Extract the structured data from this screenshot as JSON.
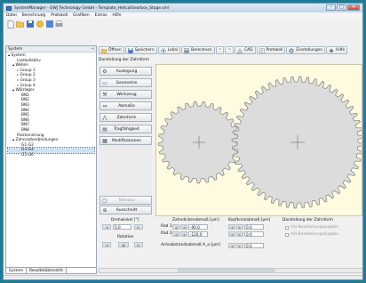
{
  "window": {
    "title": "SystemManager - GWJ Technology GmbH - Template_HelicalGearbox_Stage.sml",
    "buttons": {
      "minimize": "–",
      "maximize": "□",
      "close": "✕"
    }
  },
  "menu": [
    "Datei",
    "Berechnung",
    "Protokoll",
    "Grafiken",
    "Extras",
    "Hilfe"
  ],
  "toolbar": {
    "icons": [
      "new-file-icon",
      "open-folder-icon",
      "save-icon",
      "info-icon",
      "module-icon",
      "print-icon"
    ],
    "buttons": [
      {
        "label": "Öffnen",
        "icon": "open-icon"
      },
      {
        "label": "Speichern",
        "icon": "save-icon"
      },
      {
        "label": "Lokal",
        "icon": "radio-icon"
      },
      {
        "label": "Berechnen",
        "icon": "calculate-icon"
      },
      {
        "label": "",
        "icon": "undo-icon"
      },
      {
        "label": "",
        "icon": "redo-icon"
      },
      {
        "label": "CAD",
        "icon": "cad-icon"
      },
      {
        "label": "Protokoll",
        "icon": "report-icon"
      },
      {
        "label": "Einstellungen",
        "icon": "settings-icon"
      },
      {
        "label": "Hilfe",
        "icon": "help-icon"
      }
    ]
  },
  "left_panel": {
    "header": "System",
    "tree": [
      {
        "text": "▴ System",
        "level": 0
      },
      {
        "text": "Lastkollektiv",
        "level": 2
      },
      {
        "text": "▴ Wellen",
        "level": 1
      },
      {
        "text": "▹ Group 1",
        "level": 2
      },
      {
        "text": "▹ Group 2",
        "level": 2
      },
      {
        "text": "▹ Group 3",
        "level": 2
      },
      {
        "text": "▹ Group 4",
        "level": 2
      },
      {
        "text": "▴ Wälzlager",
        "level": 1
      },
      {
        "text": "BN1",
        "level": 3
      },
      {
        "text": "BN2",
        "level": 3
      },
      {
        "text": "BN3",
        "level": 3
      },
      {
        "text": "BN4",
        "level": 3
      },
      {
        "text": "BN5",
        "level": 3
      },
      {
        "text": "BN6",
        "level": 3
      },
      {
        "text": "BN7",
        "level": 3
      },
      {
        "text": "BN8",
        "level": 3
      },
      {
        "text": "Positionierung",
        "level": 2
      },
      {
        "text": "▴ Zahnradverbindungen",
        "level": 1
      },
      {
        "text": "G1-G2",
        "level": 3
      },
      {
        "text": "G3-G4",
        "level": 3,
        "selected": true
      },
      {
        "text": "G5-G6",
        "level": 3
      }
    ],
    "tabs": [
      "System",
      "Resultatübersicht"
    ]
  },
  "main": {
    "subtitle": "Darstellung der Zahnform",
    "side_buttons": [
      {
        "label": "Auslegung",
        "icon": "gear-icon"
      },
      {
        "label": "Geometrie",
        "icon": "geometry-icon"
      },
      {
        "label": "Werkzeug",
        "icon": "tool-icon"
      },
      {
        "label": "Abmaße",
        "icon": "tolerance-icon"
      },
      {
        "label": "Zahnform",
        "icon": "tooth-form-icon"
      },
      {
        "label": "Tragfähigkeit",
        "icon": "capacity-icon"
      },
      {
        "label": "Modifikationen",
        "icon": "modification-icon"
      }
    ],
    "bottom_side_buttons": [
      {
        "label": "Toleranz",
        "icon": "tolerance-icon",
        "enabled": false
      },
      {
        "label": "Ausschnitt",
        "icon": "zoom-icon",
        "enabled": true
      }
    ]
  },
  "gears": {
    "gear1": {
      "teeth": 29
    },
    "gear2": {
      "teeth": 52
    }
  },
  "bottom": {
    "drehwinkel_label": "Drehwinkel [°]",
    "drehwinkel_value": "0.0",
    "rotation_label": "Rotation",
    "zahndicken_header": "Zahndickenabmaß [µm]",
    "kopfkreis_header": "Kopfkreisabmaß [µm]",
    "rad1_label": "Rad 1",
    "rad2_label": "Rad 2",
    "rad1_zahndicke": "-90.0",
    "rad2_zahndicke": "-120.0",
    "rad1_kopfkreis": "0.0",
    "rad2_kopfkreis": "0.0",
    "achsabstand_label": "Achsabstandsabmaß A_a [µm]",
    "achsabstand_value": "0.0",
    "darstellung_header": "Darstellung der Zahnform",
    "check1": "mit Bearbeitungszugabe",
    "check2": "mit Bearbeitungszugabe"
  }
}
